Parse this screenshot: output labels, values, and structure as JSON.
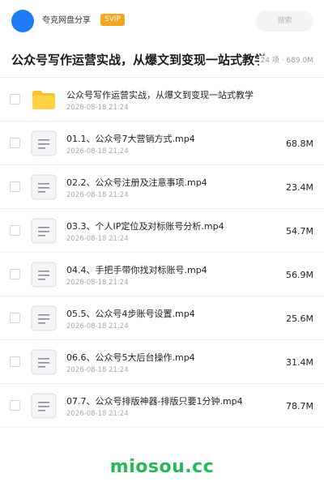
{
  "header": {
    "share_name": "夸克网盘分享",
    "badge": "SVIP",
    "search_placeholder": "搜索",
    "accent_color": "#1e7bf6",
    "badge_color": "#f3a61f"
  },
  "title_row": {
    "title": "公众号写作运营实战，从爆文到变现一站式教学",
    "meta": "24 项 · 689.0M"
  },
  "files": [
    {
      "icon": "folder-icon",
      "name": "公众号写作运营实战，从爆文到变现一站式教学",
      "date": "2026-08-18 21:24",
      "size": ""
    },
    {
      "icon": "video-file-icon",
      "name": "01.1、公众号7大营销方式.mp4",
      "date": "2026-08-18 21:24",
      "size": "68.8M"
    },
    {
      "icon": "video-file-icon",
      "name": "02.2、公众号注册及注意事项.mp4",
      "date": "2026-08-18 21:24",
      "size": "23.4M"
    },
    {
      "icon": "video-file-icon",
      "name": "03.3、个人IP定位及对标账号分析.mp4",
      "date": "2026-08-18 21:24",
      "size": "54.7M"
    },
    {
      "icon": "video-file-icon",
      "name": "04.4、手把手带你找对标账号.mp4",
      "date": "2026-08-18 21:24",
      "size": "56.9M"
    },
    {
      "icon": "video-file-icon",
      "name": "05.5、公众号4步账号设置.mp4",
      "date": "2026-08-18 21:24",
      "size": "25.6M"
    },
    {
      "icon": "video-file-icon",
      "name": "06.6、公众号5大后台操作.mp4",
      "date": "2026-08-18 21:24",
      "size": "31.4M"
    },
    {
      "icon": "video-file-icon",
      "name": "07.7、公众号排版神器-排版只要1分钟.mp4",
      "date": "2026-08-18 21:24",
      "size": "78.7M"
    }
  ],
  "watermark": {
    "text": "miosou.cc",
    "color": "#27b85b"
  }
}
